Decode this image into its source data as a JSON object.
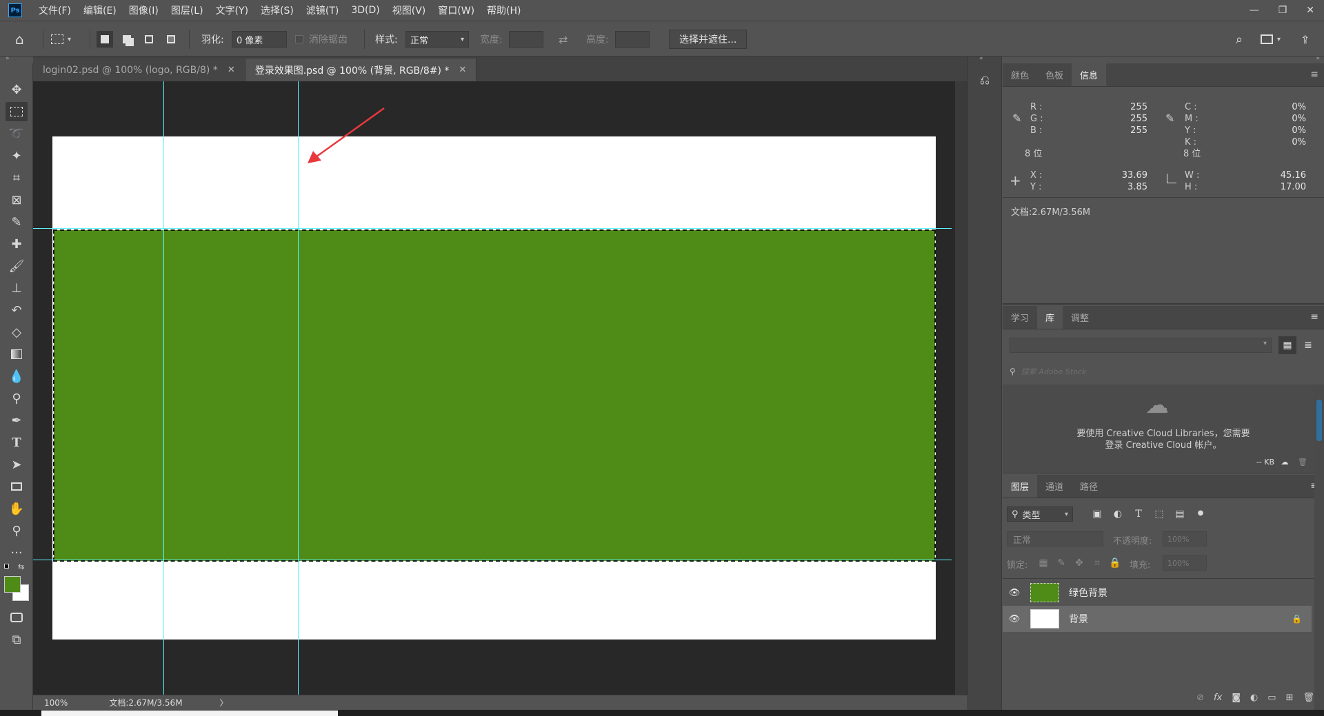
{
  "app": {
    "logo": "Ps",
    "menus": [
      "文件(F)",
      "编辑(E)",
      "图像(I)",
      "图层(L)",
      "文字(Y)",
      "选择(S)",
      "滤镜(T)",
      "3D(D)",
      "视图(V)",
      "窗口(W)",
      "帮助(H)"
    ],
    "window_controls": [
      "—",
      "❐",
      "✕"
    ]
  },
  "options": {
    "home_icon": "⌂",
    "feather_label": "羽化:",
    "feather_value": "0 像素",
    "antialias_label": "消除锯齿",
    "style_label": "样式:",
    "style_value": "正常",
    "width_label": "宽度:",
    "swap_icon": "⇄",
    "height_label": "高度:",
    "select_mask_button": "选择并遮住..."
  },
  "tabs": [
    {
      "label": "login02.psd @ 100% (logo, RGB/8) *",
      "close": "✕"
    },
    {
      "label": "登录效果图.psd @ 100% (背景, RGB/8#) *",
      "close": "✕"
    }
  ],
  "status": {
    "zoom": "100%",
    "doc": "文档:2.67M/3.56M",
    "arrow": "〉"
  },
  "colors": {
    "fg": "#4f8c17",
    "bg": "#ffffff",
    "green_fill": "#4f8c17",
    "guide": "#5cf3ff",
    "arrow": "#e8383d"
  },
  "info_panel": {
    "tabs": [
      "颜色",
      "色板",
      "信息"
    ],
    "menu_icon": "≡",
    "rgb_labels": [
      "R :",
      "G :",
      "B :"
    ],
    "rgb_values": [
      "255",
      "255",
      "255"
    ],
    "rgb_bits": "8 位",
    "cmyk_labels": [
      "C :",
      "M :",
      "Y :",
      "K :"
    ],
    "cmyk_values": [
      "0%",
      "0%",
      "0%",
      "0%"
    ],
    "cmyk_bits": "8 位",
    "xy_labels": [
      "X :",
      "Y :"
    ],
    "xy_values": [
      "33.69",
      "3.85"
    ],
    "wh_labels": [
      "W :",
      "H :"
    ],
    "wh_values": [
      "45.16",
      "17.00"
    ],
    "doc": "文档:2.67M/3.56M"
  },
  "library_panel": {
    "tabs": [
      "学习",
      "库",
      "调整"
    ],
    "search_placeholder": "搜索 Adobe Stock",
    "message_line1": "要使用 Creative Cloud Libraries，您需要",
    "message_line2": "登录 Creative Cloud 帐户。",
    "size": "-- KB"
  },
  "layers_panel": {
    "tabs": [
      "图层",
      "通道",
      "路径"
    ],
    "filter_label": "类型",
    "blend_mode": "正常",
    "opacity_label": "不透明度:",
    "opacity_value": "100%",
    "lock_label": "锁定:",
    "fill_label": "填充:",
    "fill_value": "100%",
    "layers": [
      {
        "name": "绿色背景",
        "visible": true,
        "locked": false
      },
      {
        "name": "背景",
        "visible": true,
        "locked": true
      }
    ],
    "bottom_icons": [
      "⊘",
      "fx",
      "◙",
      "◐",
      "▭",
      "⊞",
      "🗑"
    ]
  }
}
